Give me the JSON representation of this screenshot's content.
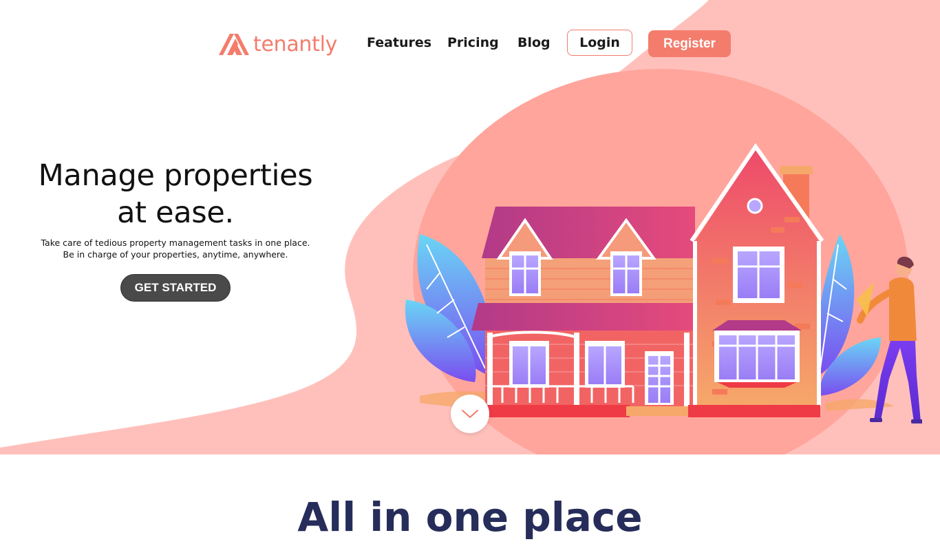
{
  "brand": {
    "name": "tenantly",
    "color": "#f47c6c"
  },
  "nav": {
    "links": [
      "Features",
      "Pricing",
      "Blog"
    ],
    "login_label": "Login",
    "register_label": "Register"
  },
  "hero": {
    "title_line1": "Manage properties",
    "title_line2": "at ease.",
    "subtitle_line1": "Take care of tedious property management tasks in one place.",
    "subtitle_line2": "Be in charge of your properties, anytime, anywhere.",
    "cta_label": "GET STARTED",
    "background_color": "#ffc0bb"
  },
  "scroll_down_icon": "chevron-down-icon",
  "section": {
    "title": "All in one place"
  }
}
